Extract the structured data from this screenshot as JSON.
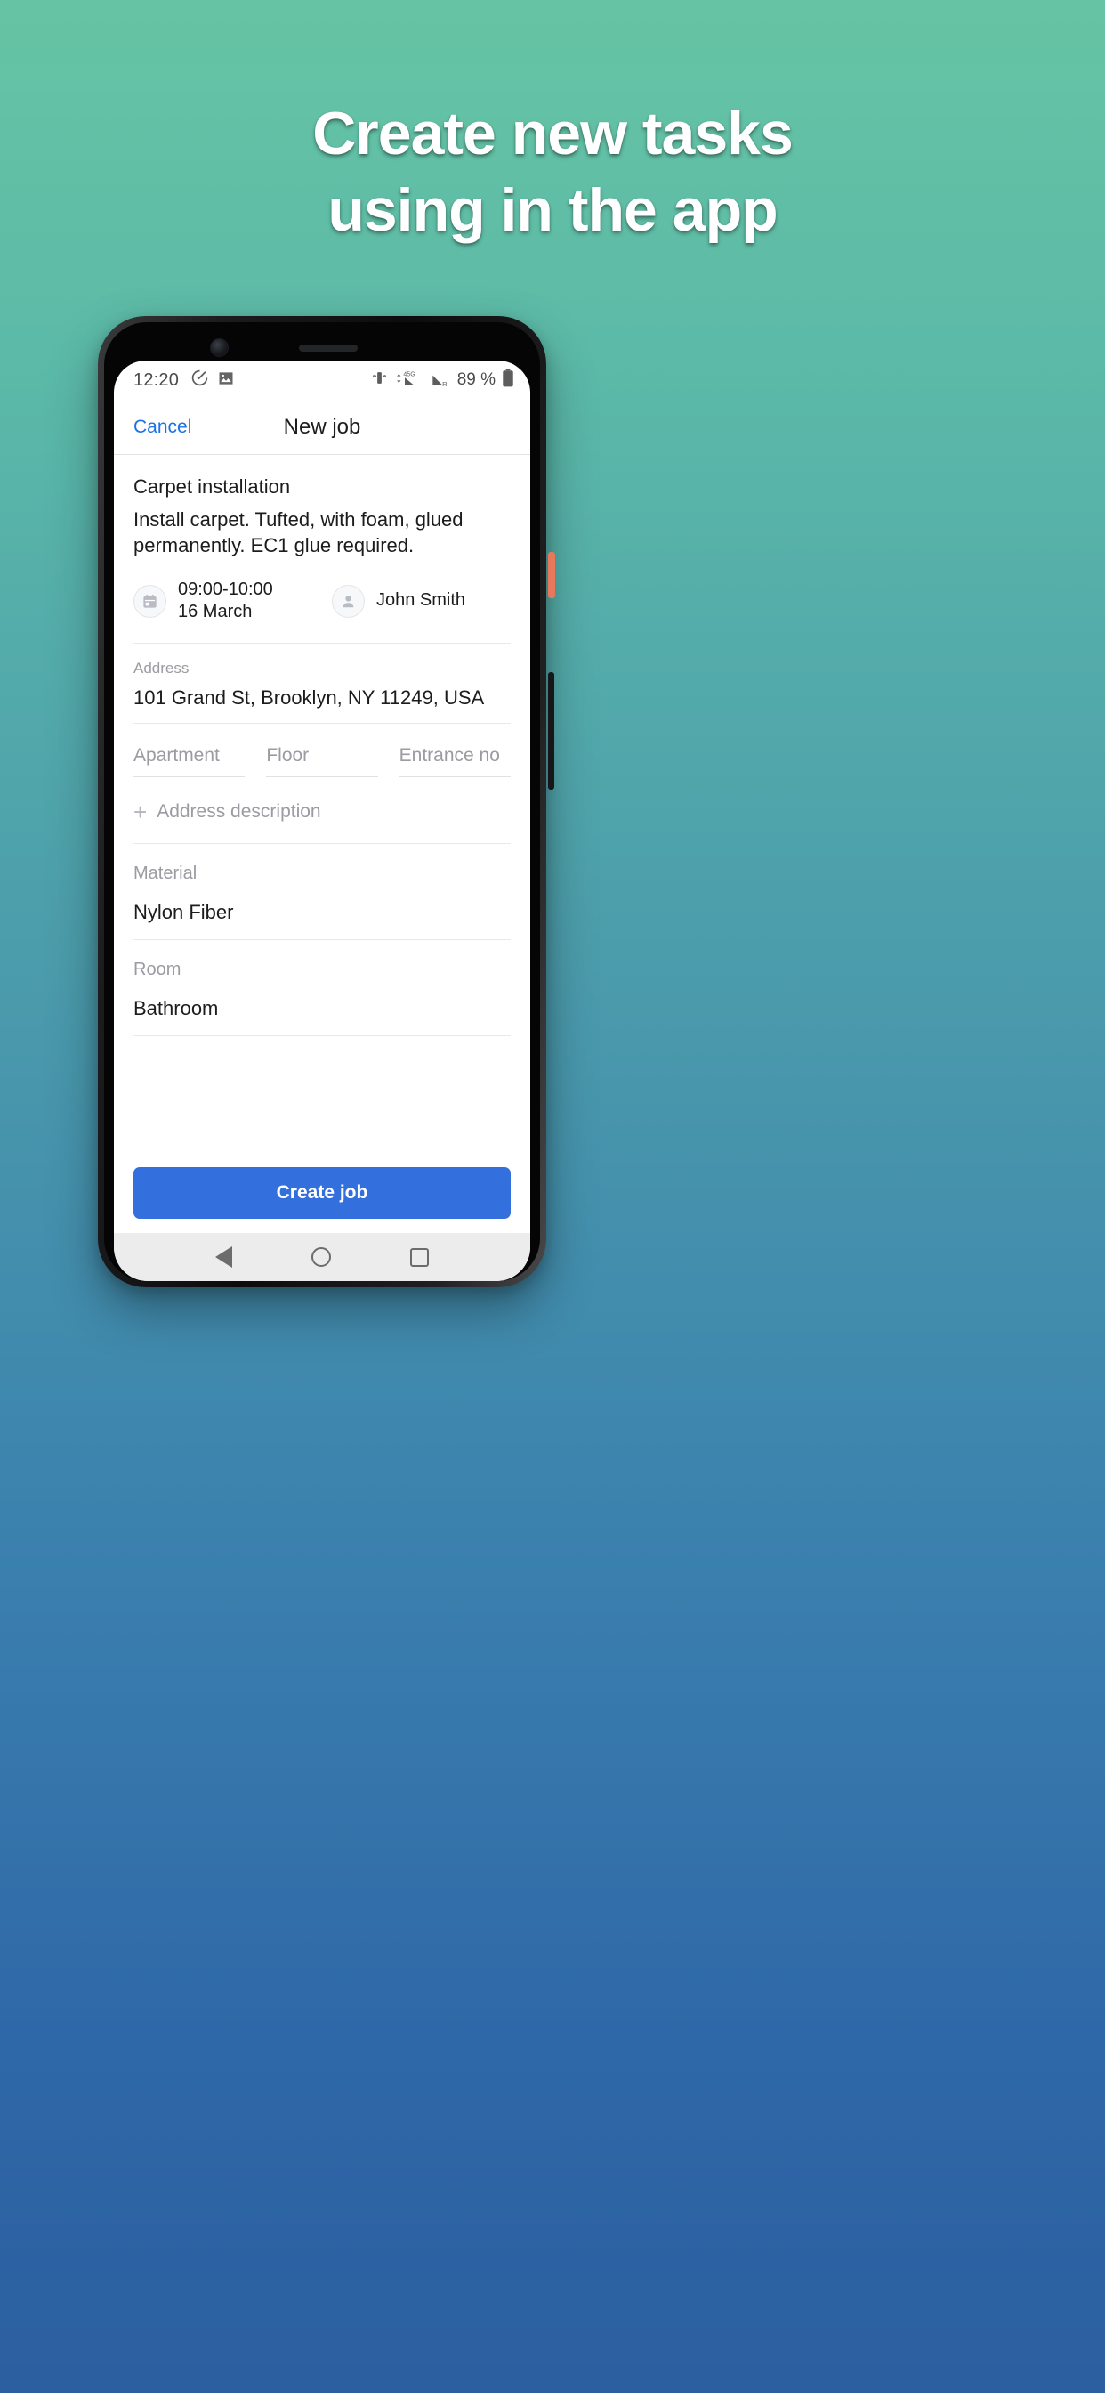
{
  "promo": {
    "headline_line1": "Create new tasks",
    "headline_line2": "using in the app",
    "background_top_color": "#66c4a4",
    "background_bottom_color": "#2b5fa0"
  },
  "status_bar": {
    "time": "12:20",
    "left_icons": [
      "task-check-icon",
      "image-icon"
    ],
    "vibrate_icon": "vibrate-icon",
    "network_label": "45G",
    "roaming_label": "R",
    "battery_percent": "89 %",
    "battery_icon": "battery-full-icon"
  },
  "nav_header": {
    "cancel_label": "Cancel",
    "title": "New job",
    "cancel_color": "#1a73e8"
  },
  "job": {
    "title": "Carpet installation",
    "description": "Install carpet. Tufted, with foam, glued permanently. EC1 glue required.",
    "schedule": {
      "icon": "calendar-icon",
      "time_range": "09:00-10:00",
      "date": "16 March"
    },
    "assignee": {
      "icon": "person-icon",
      "name": "John Smith"
    }
  },
  "address_section": {
    "label": "Address",
    "value": "101 Grand St, Brooklyn, NY 11249, USA"
  },
  "address_details": {
    "apartment_placeholder": "Apartment",
    "floor_placeholder": "Floor",
    "entrance_placeholder": "Entrance no"
  },
  "address_description": {
    "plus_icon": "plus-icon",
    "label": "Address description"
  },
  "material_section": {
    "label": "Material",
    "value": "Nylon Fiber"
  },
  "room_section": {
    "label": "Room",
    "value": "Bathroom"
  },
  "cta": {
    "label": "Create job",
    "color": "#3370dd"
  },
  "android_nav": {
    "back": "back-triangle-icon",
    "home": "home-circle-icon",
    "recents": "recents-square-icon"
  }
}
